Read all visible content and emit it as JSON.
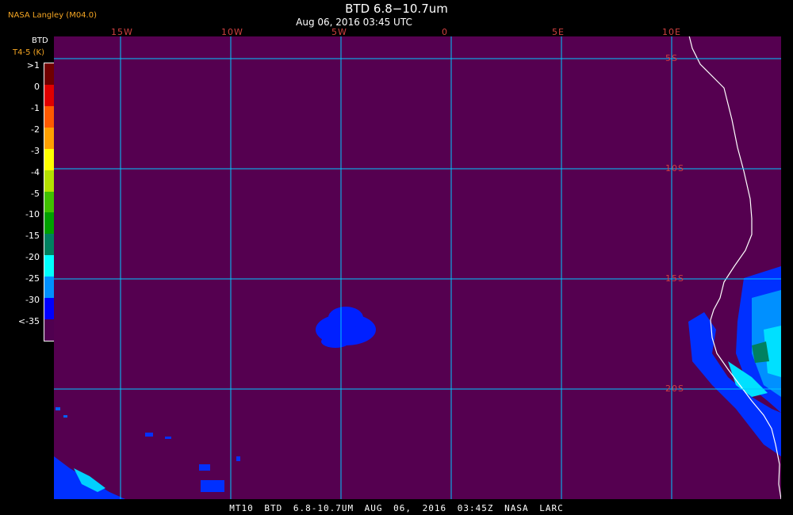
{
  "header": {
    "agency": "NASA Langley (M04.0)",
    "title": "BTD 6.8−10.7um",
    "subtitle": "Aug 06, 2016 03:45 UTC"
  },
  "legend": {
    "unit_line1": "BTD",
    "unit_line2": "T4-5 (K)",
    "labels": [
      ">1",
      "0",
      "-1",
      "-2",
      "-3",
      "-4",
      "-5",
      "-10",
      "-15",
      "-20",
      "-25",
      "-30",
      "<-35"
    ],
    "colors": [
      "#700000",
      "#e00000",
      "#ff5a00",
      "#ffa000",
      "#ffff00",
      "#b4e000",
      "#40c000",
      "#00a000",
      "#008060",
      "#00ffff",
      "#0090ff",
      "#0000ff",
      "#500050"
    ]
  },
  "map": {
    "background": "#550050",
    "grid_color": "#00c8ff",
    "longitude_labels": [
      "15W",
      "10W",
      "5W",
      "0",
      "5E",
      "10E"
    ],
    "latitude_labels": [
      "5S",
      "10S",
      "15S",
      "20S"
    ]
  },
  "footer": {
    "text": "MT10  BTD 6.8-10.7UM  AUG 06, 2016 03:45Z  NASA LARC"
  }
}
